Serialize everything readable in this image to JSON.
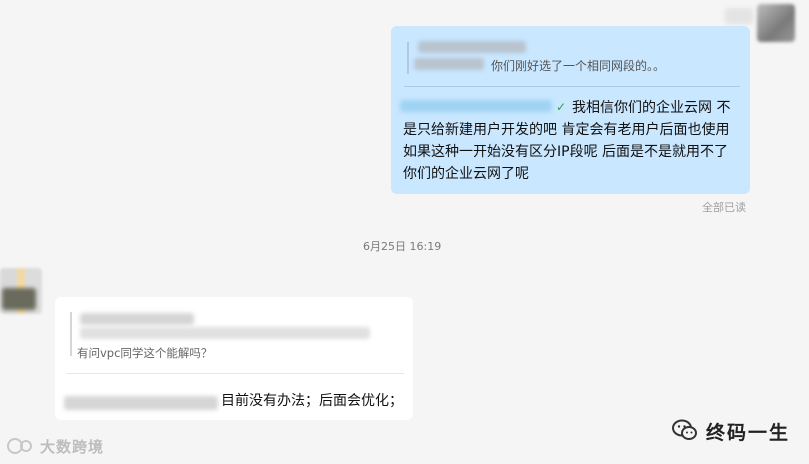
{
  "chat": {
    "outgoing": {
      "quote_text": "你们刚好选了一个相同网段的。。",
      "message_lines": [
        "我相信你们的企业云网 不",
        "是只给新建用户开发的吧  肯定会有老用户后面也使用",
        "如果这种一开始没有区分IP段呢  后面是不是就用不了",
        "你们的企业云网了呢"
      ],
      "read_status": "全部已读"
    },
    "timestamp": "6月25日 16:19",
    "incoming": {
      "quote_text": "有问vpc同学这个能解吗？",
      "message": "目前没有办法；后面会优化；"
    }
  },
  "watermarks": {
    "left_text": "大数跨境",
    "right_text": "终码一生"
  },
  "icons": {
    "read_check": "check-icon",
    "wechat": "wechat-logo-icon",
    "left_logo": "brand-logo-icon"
  },
  "colors": {
    "background": "#f5f5f5",
    "outgoing_bubble": "#c9e7ff",
    "incoming_bubble": "#ffffff"
  }
}
